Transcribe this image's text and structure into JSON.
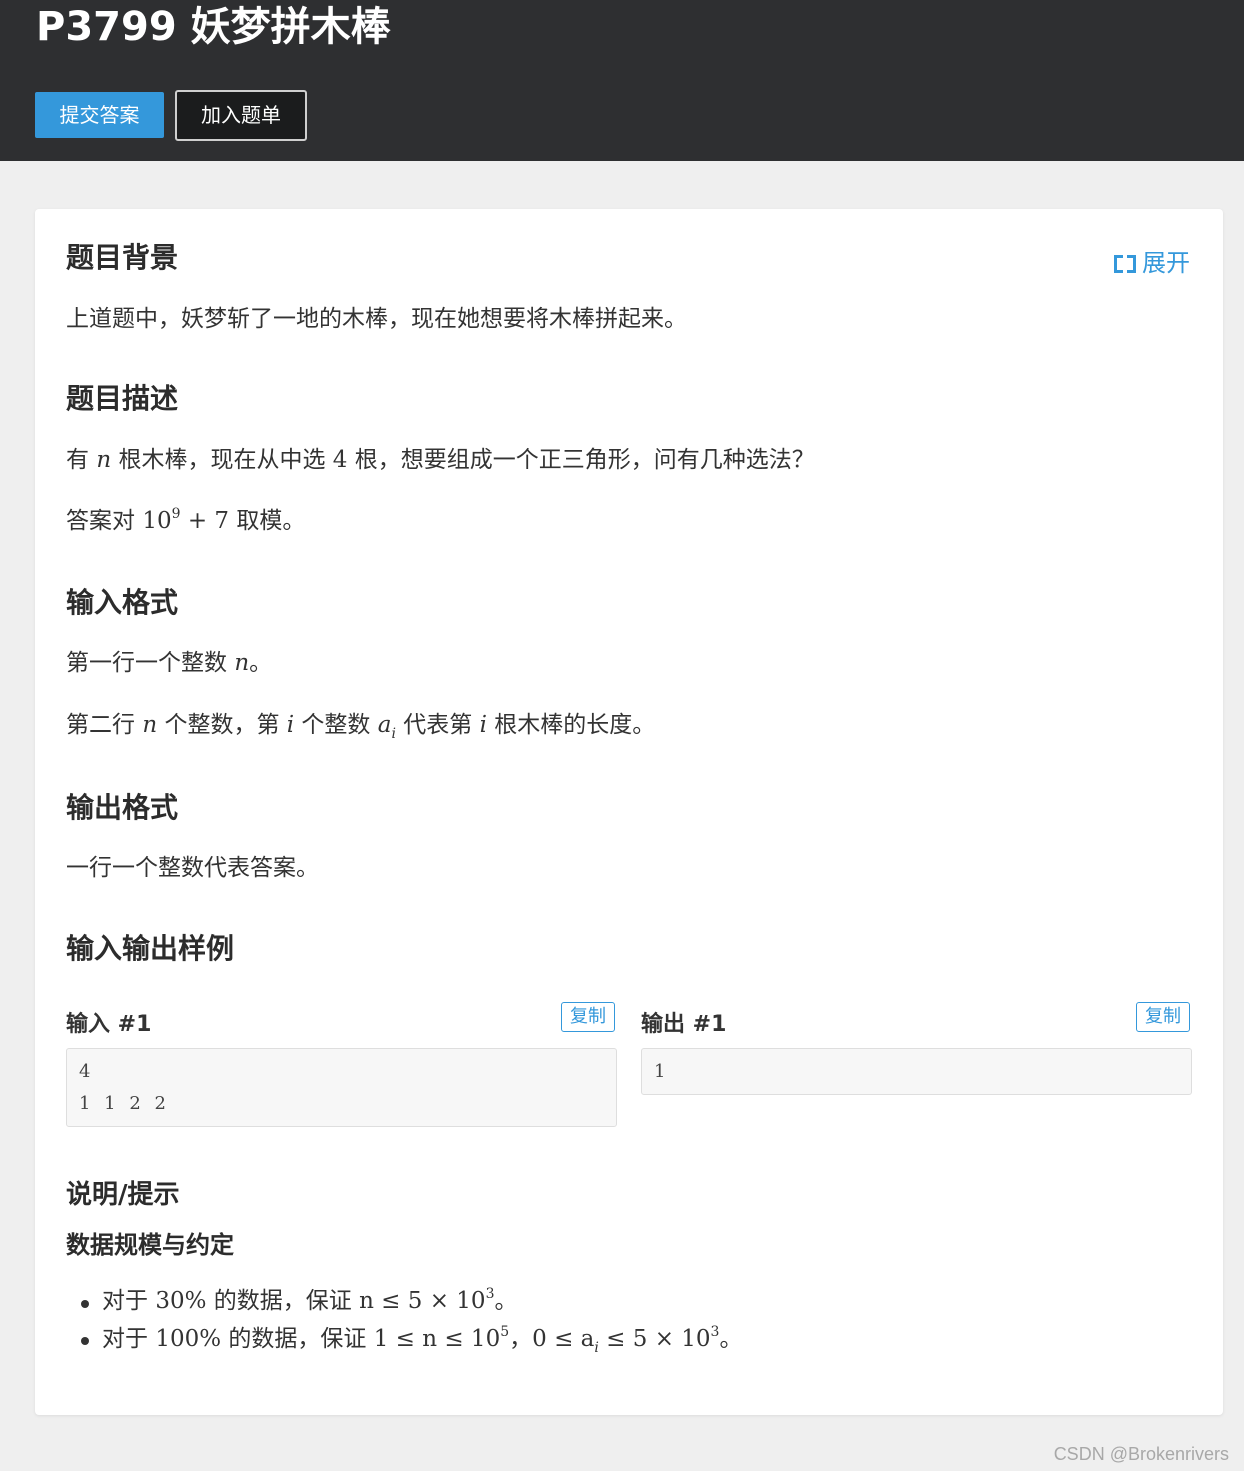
{
  "header": {
    "title": "P3799 妖梦拼木棒",
    "submit_label": "提交答案",
    "add_label": "加入题单"
  },
  "expand_label": "展开",
  "sections": {
    "background": {
      "title": "题目背景",
      "text": "上道题中，妖梦斩了一地的木棒，现在她想要将木棒拼起来。"
    },
    "description": {
      "title": "题目描述",
      "line1": {
        "a": "有 ",
        "n": "n",
        "b": " 根木棒，现在从中选 ",
        "k": "4",
        "c": " 根，想要组成一个正三角形，问有几种选法？"
      },
      "line2": {
        "a": "答案对 ",
        "base": "10",
        "exp": "9",
        "rest": " + 7",
        "b": " 取模。"
      }
    },
    "input_format": {
      "title": "输入格式",
      "line1": {
        "a": "第一行一个整数 ",
        "n": "n",
        "b": "。"
      },
      "line2": {
        "a": "第二行 ",
        "n": "n",
        "b": " 个整数，第 ",
        "i": "i",
        "c": " 个整数 ",
        "ai": "a",
        "ai_sub": "i",
        "d": " 代表第 ",
        "i2": "i",
        "e": " 根木棒的长度。"
      }
    },
    "output_format": {
      "title": "输出格式",
      "text": "一行一个整数代表答案。"
    },
    "samples": {
      "title": "输入输出样例",
      "input_label": "输入 #1",
      "output_label": "输出 #1",
      "copy_label": "复制",
      "input_lines": [
        "4",
        "1 1 2 2"
      ],
      "output_lines": [
        "1"
      ]
    },
    "hint": {
      "title": "说明/提示",
      "subtitle": "数据规模与约定",
      "item1": {
        "a": "对于 ",
        "pct": "30%",
        "b": " 的数据，保证 ",
        "math": "n ≤ 5 × 10",
        "exp": "3",
        "c": "。"
      },
      "item2": {
        "a": "对于 ",
        "pct": "100%",
        "b": " 的数据，保证 ",
        "math1": "1 ≤ n ≤ 10",
        "exp1": "5",
        "sep": "，",
        "math2a": "0 ≤ a",
        "sub": "i",
        "math2b": " ≤ 5 × 10",
        "exp2": "3",
        "c": "。"
      }
    }
  },
  "watermark": "CSDN @Brokenrivers",
  "colors": {
    "header_bg": "#2e2f31",
    "accent": "#3498db",
    "page_bg": "#efefef"
  }
}
